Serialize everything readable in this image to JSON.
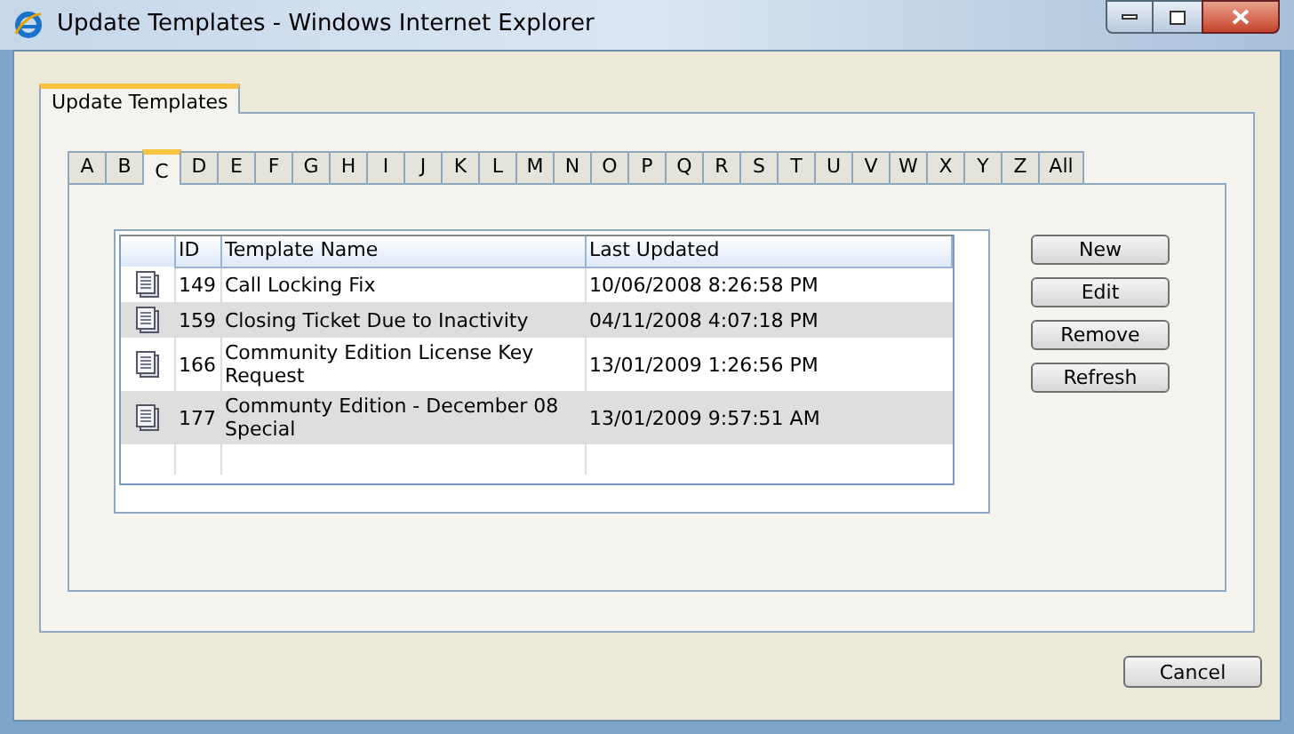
{
  "window": {
    "title": "Update Templates - Windows Internet Explorer"
  },
  "page_tabs": [
    {
      "label": "Update Templates",
      "selected": true
    }
  ],
  "letter_tabs": [
    {
      "label": "A",
      "selected": false
    },
    {
      "label": "B",
      "selected": false
    },
    {
      "label": "C",
      "selected": true
    },
    {
      "label": "D",
      "selected": false
    },
    {
      "label": "E",
      "selected": false
    },
    {
      "label": "F",
      "selected": false
    },
    {
      "label": "G",
      "selected": false
    },
    {
      "label": "H",
      "selected": false
    },
    {
      "label": "I",
      "selected": false
    },
    {
      "label": "J",
      "selected": false
    },
    {
      "label": "K",
      "selected": false
    },
    {
      "label": "L",
      "selected": false
    },
    {
      "label": "M",
      "selected": false
    },
    {
      "label": "N",
      "selected": false
    },
    {
      "label": "O",
      "selected": false
    },
    {
      "label": "P",
      "selected": false
    },
    {
      "label": "Q",
      "selected": false
    },
    {
      "label": "R",
      "selected": false
    },
    {
      "label": "S",
      "selected": false
    },
    {
      "label": "T",
      "selected": false
    },
    {
      "label": "U",
      "selected": false
    },
    {
      "label": "V",
      "selected": false
    },
    {
      "label": "W",
      "selected": false
    },
    {
      "label": "X",
      "selected": false
    },
    {
      "label": "Y",
      "selected": false
    },
    {
      "label": "Z",
      "selected": false
    },
    {
      "label": "All",
      "selected": false
    }
  ],
  "table": {
    "columns": [
      "ID",
      "Template Name",
      "Last Updated"
    ],
    "rows": [
      {
        "id": "149",
        "name": "Call Locking Fix",
        "updated": "10/06/2008 8:26:58 PM"
      },
      {
        "id": "159",
        "name": "Closing Ticket Due to Inactivity",
        "updated": "04/11/2008 4:07:18 PM"
      },
      {
        "id": "166",
        "name": "Community Edition License Key Request",
        "updated": "13/01/2009 1:26:56 PM"
      },
      {
        "id": "177",
        "name": "Communty Edition - December 08 Special",
        "updated": "13/01/2009 9:57:51 AM"
      }
    ]
  },
  "actions": [
    "New",
    "Edit",
    "Remove",
    "Refresh"
  ],
  "footer_buttons": [
    "Cancel"
  ]
}
